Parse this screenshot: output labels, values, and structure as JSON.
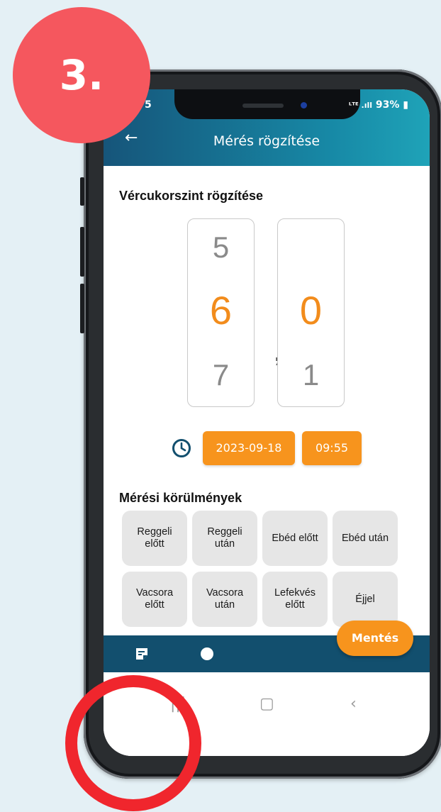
{
  "step_badge": "3.",
  "status_bar": {
    "left": "5",
    "signal": "ᴸᵀᴱ .ıll",
    "battery": "93%"
  },
  "header": {
    "title": "Mérés rögzítése"
  },
  "form": {
    "section_title": "Vércukorszint rögzítése",
    "picker_integer": {
      "above": "5",
      "selected": "6",
      "below": "7"
    },
    "decimal_separator": ",",
    "picker_decimal": {
      "above": "",
      "selected": "0",
      "below": "1"
    },
    "date": "2023-09-18",
    "time": "09:55"
  },
  "conditions": {
    "title": "Mérési körülmények",
    "options": [
      "Reggeli\nelőtt",
      "Reggeli\nután",
      "Ebéd előtt",
      "Ebéd után",
      "Vacsora\nelőtt",
      "Vacsora\nután",
      "Lefekvés\nelőtt",
      "Éjjel"
    ]
  },
  "actions": {
    "save_label": "Mentés"
  },
  "colors": {
    "accent": "#f7941d",
    "header": "#1789a6",
    "nav": "#124f6e",
    "badge": "#f5575e",
    "highlight_ring": "#f0262d"
  },
  "icons": [
    "back-arrow-icon",
    "clock-icon",
    "note-icon",
    "chart-icon",
    "recent-apps-icon",
    "home-icon",
    "back-icon"
  ]
}
